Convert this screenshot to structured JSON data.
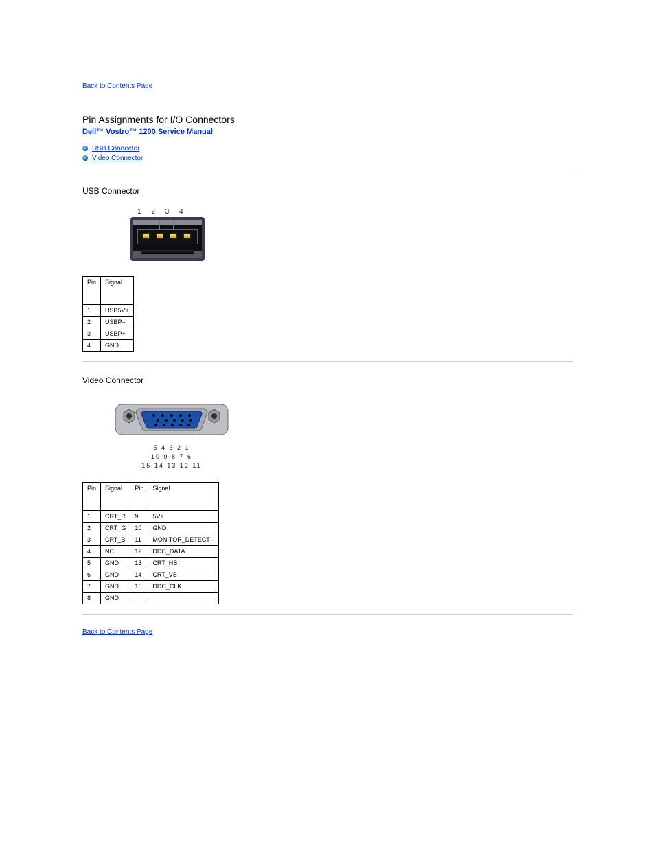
{
  "nav": {
    "back_to_contents": "Back to Contents Page"
  },
  "header": {
    "page_title": "Pin Assignments for I/O Connectors",
    "manual_title": "Dell™ Vostro™ 1200 Service Manual"
  },
  "toc": [
    "USB Connector",
    "Video Connector"
  ],
  "sections": {
    "usb": {
      "title": "USB Connector",
      "figure": {
        "pin_row_label": "1 2 3 4"
      },
      "table": {
        "headers": [
          "Pin",
          "Signal"
        ],
        "rows": [
          [
            "1",
            "USB5V+"
          ],
          [
            "2",
            "USBP–"
          ],
          [
            "3",
            "USBP+"
          ],
          [
            "4",
            "GND"
          ]
        ]
      }
    },
    "video": {
      "title": "Video Connector",
      "figure": {
        "row1": "5  4  3  2  1",
        "row2": "10  9  8  7  6",
        "row3": "15 14 13 12 11"
      },
      "table": {
        "headers": [
          "Pin",
          "Signal",
          "Pin",
          "Signal"
        ],
        "rows": [
          [
            "1",
            "CRT_R",
            "9",
            "5V+"
          ],
          [
            "2",
            "CRT_G",
            "10",
            "GND"
          ],
          [
            "3",
            "CRT_B",
            "11",
            "MONITOR_DETECT–"
          ],
          [
            "4",
            "NC",
            "12",
            "DDC_DATA"
          ],
          [
            "5",
            "GND",
            "13",
            "CRT_HS"
          ],
          [
            "6",
            "GND",
            "14",
            "CRT_VS"
          ],
          [
            "7",
            "GND",
            "15",
            "DDC_CLK"
          ],
          [
            "8",
            "GND",
            "",
            ""
          ]
        ]
      }
    }
  }
}
